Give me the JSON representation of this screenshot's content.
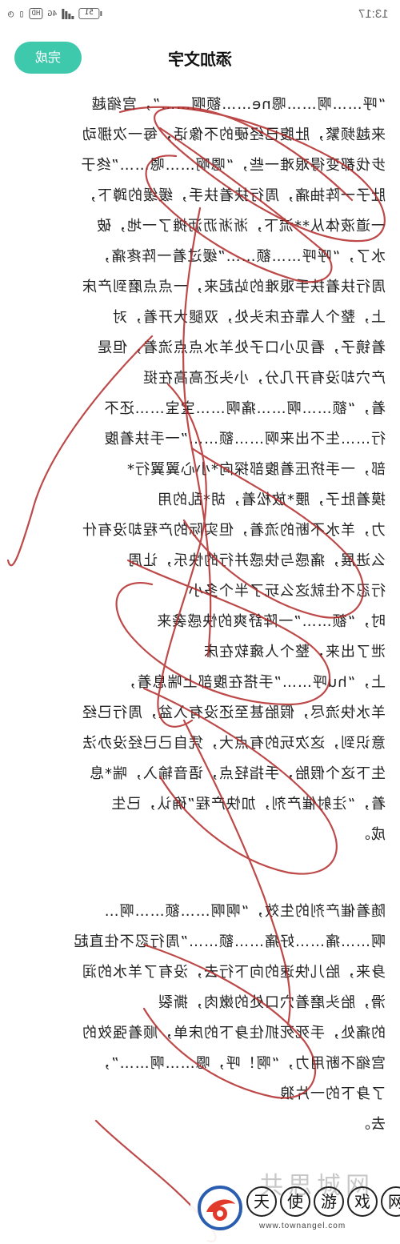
{
  "status_bar": {
    "battery": "51",
    "network": "4G",
    "hd": "HD",
    "time": "13:17"
  },
  "header": {
    "done_label": "完成",
    "title": "添加文字"
  },
  "body_lines": [
    "“呼……啊……嗯ne……额啊……”，宫缩越",
    "来越频繁，肚腹已经硬的不像话，每一次挪动",
    "步伐都变得艰难一些，“嗯啊……嗯……”终于",
    "肚子一阵抽痛，周行扶着扶手，缓缓的蹲下，",
    "一道液体从**流下，淅淅沥沥摊了一地，破",
    "水了，“呼呼……额……”缓过着一阵疼痛，",
    "周行扶着扶手艰难的站起来，一点点磨到产床",
    "上，整个人靠在床头处，双腿大开着，对",
    "着镜子，看见小口子处羊水点点流着，但是",
    "产穴却没有开几分，小头还高高在挺",
    "着，“额……啊……痛啊……宝宝……还不",
    "行……生不出来啊……额……”一手扶着腹",
    "部，一手挤压着腹部探向*小心翼翼行*",
    "摸着肚子，腰*放松着，胡*乱的用",
    "力，羊水不断的流着，但实际的产程却没有什",
    "么进展，痛感与快感并行的快乐，让周",
    "行忍不住就这么玩了半个多小",
    "时，“额……”一阵舒爽的快感袭来",
    "泄了出来，整个人瘫软在床",
    "上，“hu呼……”手搭在腹部上喘息着，",
    "羊水快流尽，假胎甚至还没有入盆，周行已经",
    "意识到，这次玩的有点大，凭自己已经没办法",
    "生下这个假胎，手指轻点，语音输入，喘*息",
    "着，“注射催产剂，加快产程”确认，已生",
    "成。",
    "",
    "随着催产剂的生效，“啊啊……额……啊…",
    "啊……痛……好痛……额……”周行忍不住直起",
    "身来，胎儿快速的向下行去，没有了羊水的润",
    "滑，胎头磨着穴口处的嫩肉，撕裂",
    "的痛处，手死死抓住身下的床单，顺着强效的",
    "宫缩不断用力，“啊！呼，嗯……啊……”，",
    "了身下的一片狼",
    "去。"
  ],
  "watermark": {
    "logo_name": "tianshi-logo",
    "chars": [
      "天",
      "使",
      "游",
      "戏",
      "网"
    ],
    "url": "www.townangel.com",
    "faded_text": "共思城网"
  },
  "colors": {
    "accent": "#3ec9ad",
    "scribble": "#b22a2a"
  }
}
